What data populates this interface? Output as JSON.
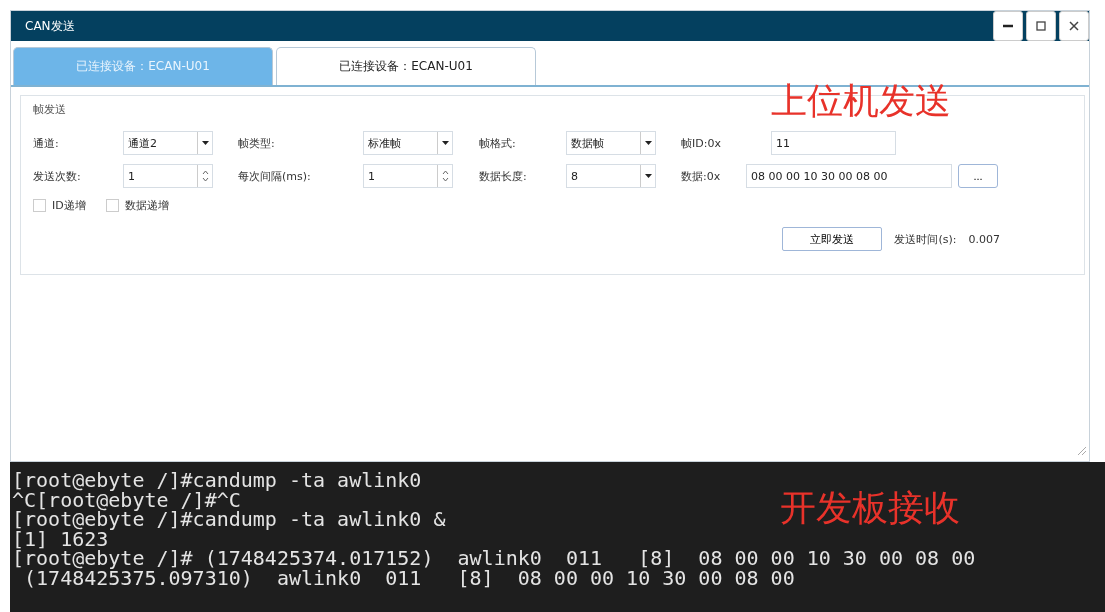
{
  "window": {
    "title": "CAN发送"
  },
  "tabs": [
    {
      "label": "已连接设备：ECAN-U01",
      "selected": true
    },
    {
      "label": "已连接设备：ECAN-U01",
      "selected": false
    }
  ],
  "frame_send": {
    "title": "帧发送",
    "rows": [
      [
        {
          "kind": "select",
          "label": "通道:",
          "value": "通道2"
        },
        {
          "kind": "select",
          "label": "帧类型:",
          "value": "标准帧"
        },
        {
          "kind": "select",
          "label": "帧格式:",
          "value": "数据帧"
        },
        {
          "kind": "text",
          "label": "帧ID:0x",
          "value": "11"
        }
      ],
      [
        {
          "kind": "spin",
          "label": "发送次数:",
          "value": "1"
        },
        {
          "kind": "spin",
          "label": "每次间隔(ms):",
          "value": "1"
        },
        {
          "kind": "select",
          "label": "数据长度:",
          "value": "8"
        },
        {
          "kind": "text",
          "label": "数据:0x",
          "value": "08 00 00 10 30 00 08 00",
          "button": "..."
        }
      ]
    ],
    "checkboxes": [
      {
        "label": "ID递增",
        "checked": false
      },
      {
        "label": "数据递增",
        "checked": false
      }
    ],
    "send_button": "立即发送",
    "send_time_label": "发送时间(s):",
    "send_time_value": "0.007"
  },
  "annotation_send": "上位机发送",
  "terminal": {
    "lines": [
      "[root@ebyte /]#candump -ta awlink0",
      "^C[root@ebyte /]#^C",
      "[root@ebyte /]#candump -ta awlink0 &",
      "[1] 1623",
      "[root@ebyte /]# (1748425374.017152)  awlink0  011   [8]  08 00 00 10 30 00 08 00",
      " (1748425375.097310)  awlink0  011   [8]  08 00 00 10 30 00 08 00"
    ]
  },
  "annotation_receive": "开发板接收"
}
